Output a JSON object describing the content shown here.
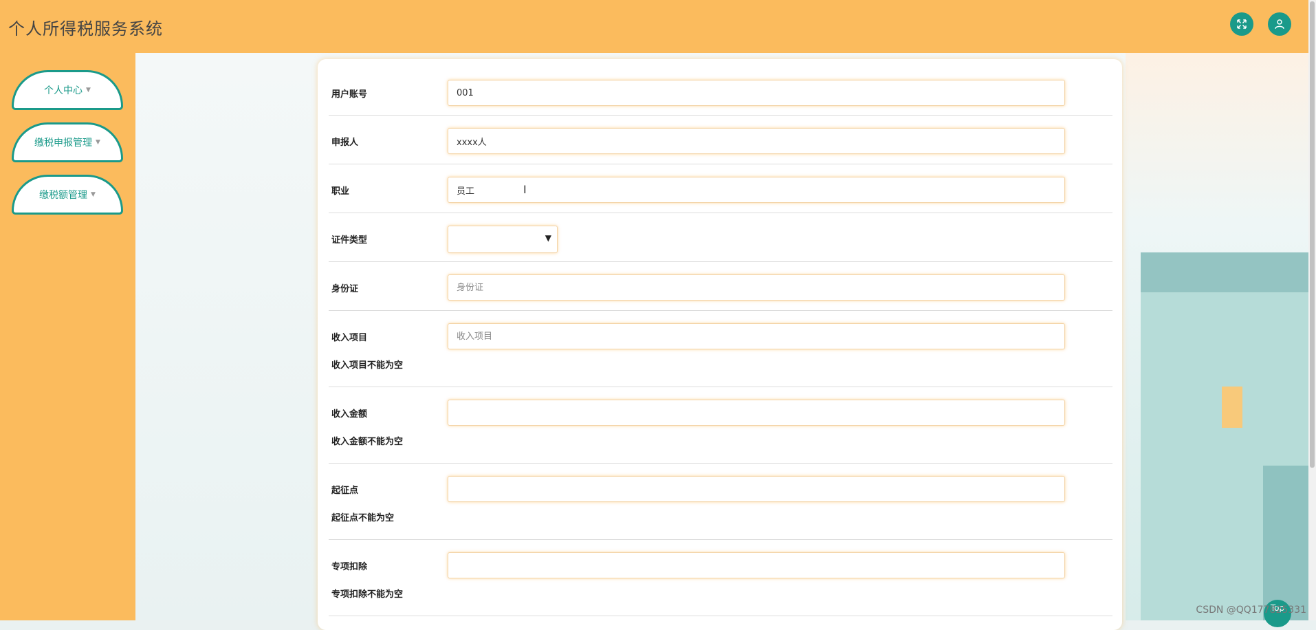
{
  "header": {
    "title": "个人所得税服务系统",
    "icons": {
      "fullscreen": "expand-icon",
      "user": "user-icon"
    }
  },
  "sidebar": {
    "items": [
      {
        "label": "个人中心"
      },
      {
        "label": "缴税申报管理"
      },
      {
        "label": "缴税额管理"
      }
    ]
  },
  "form": {
    "fields": [
      {
        "label": "用户账号",
        "value": "001",
        "placeholder": ""
      },
      {
        "label": "申报人",
        "value": "xxxx人",
        "placeholder": ""
      },
      {
        "label": "职业",
        "value": "员工",
        "placeholder": ""
      },
      {
        "label": "证件类型",
        "value": ""
      },
      {
        "label": "身份证",
        "value": "",
        "placeholder": "身份证"
      },
      {
        "label": "收入项目",
        "value": "",
        "placeholder": "收入项目",
        "error": "收入项目不能为空"
      },
      {
        "label": "收入金额",
        "value": "",
        "placeholder": "",
        "error": "收入金额不能为空"
      },
      {
        "label": "起征点",
        "value": "",
        "placeholder": "",
        "error": "起征点不能为空"
      },
      {
        "label": "专项扣除",
        "value": "",
        "placeholder": "",
        "error": "专项扣除不能为空"
      }
    ]
  },
  "watermark": "CSDN @QQ177825331",
  "top_button": "Top",
  "colors": {
    "accent": "#1a9a8a",
    "brand": "#fbbb5d"
  }
}
